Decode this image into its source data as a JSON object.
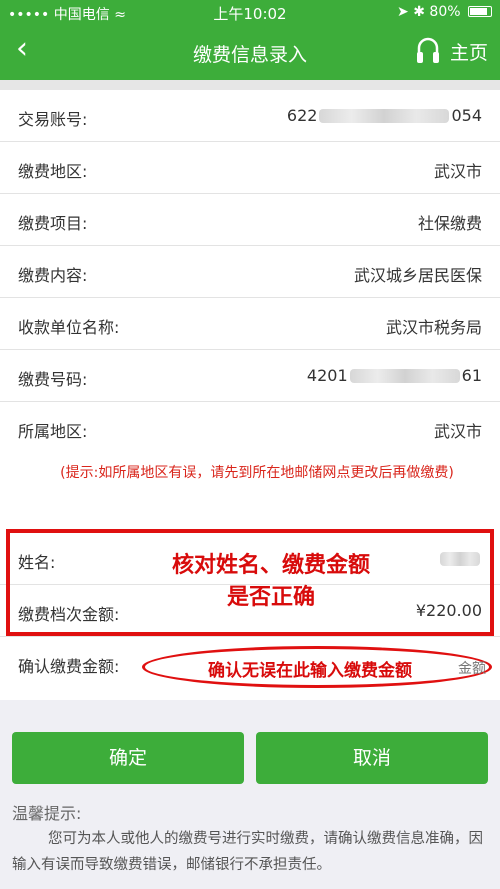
{
  "status_bar": {
    "carrier": "中国电信",
    "time": "上午10:02",
    "battery": "80%"
  },
  "nav": {
    "title": "缴费信息录入",
    "home_label": "主页"
  },
  "fields": [
    {
      "label": "交易账号:",
      "value_prefix": "622",
      "value_suffix": "054",
      "masked": true
    },
    {
      "label": "缴费地区:",
      "value": "武汉市"
    },
    {
      "label": "缴费项目:",
      "value": "社保缴费"
    },
    {
      "label": "缴费内容:",
      "value": "武汉城乡居民医保"
    },
    {
      "label": "收款单位名称:",
      "value": "武汉市税务局"
    },
    {
      "label": "缴费号码:",
      "value_prefix": "4201",
      "value_suffix": "61",
      "masked": true
    },
    {
      "label": "所属地区:",
      "value": "武汉市"
    }
  ],
  "tip": "(提示:如所属地区有误，请先到所在地邮储网点更改后再做缴费)",
  "name_row": {
    "label": "姓名:"
  },
  "amount_row": {
    "label": "缴费档次金额:",
    "value": "¥220.00"
  },
  "confirm_row": {
    "label": "确认缴费金额:",
    "placeholder": "金额"
  },
  "annotations": {
    "check_line1": "核对姓名、缴费金额",
    "check_line2": "是否正确",
    "confirm_hint": "确认无误在此输入缴费金额"
  },
  "buttons": {
    "ok": "确定",
    "cancel": "取消"
  },
  "notice": {
    "title": "温馨提示:",
    "body": "您可为本人或他人的缴费号进行实时缴费，请确认缴费信息准确，因输入有误而导致缴费错误，邮储银行不承担责任。"
  },
  "colors": {
    "brand_green": "#3dad3a",
    "annotation_red": "#e01010"
  }
}
